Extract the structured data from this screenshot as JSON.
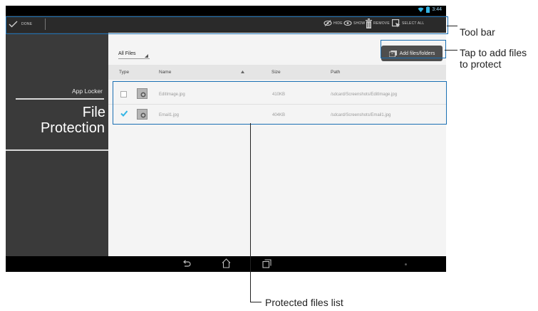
{
  "status_bar": {
    "time": "3:44"
  },
  "toolbar": {
    "done_label": "DONE",
    "hide_label": "HIDE",
    "show_label": "SHOW",
    "remove_label": "REMOVE",
    "select_all_label": "SELECT ALL"
  },
  "sidebar": {
    "app_name": "App Locker",
    "section_title_line1": "File",
    "section_title_line2": "Protection"
  },
  "main": {
    "filter_label": "All Files",
    "add_button_label": "Add files/folders",
    "columns": {
      "type": "Type",
      "name": "Name",
      "size": "Size",
      "path": "Path"
    },
    "rows": [
      {
        "checked": false,
        "name": "EditImage.jpg",
        "size": "410KB",
        "path": "/sdcard/Screenshots/EditImage.jpg"
      },
      {
        "checked": true,
        "name": "Email1.jpg",
        "size": "404KB",
        "path": "/sdcard/Screenshots/Email1.jpg"
      }
    ]
  },
  "callouts": {
    "toolbar": "Tool bar",
    "add_files_line1": "Tap to add files",
    "add_files_line2": "to protect",
    "files_list": "Protected files list"
  },
  "colors": {
    "accent": "#33b5e5",
    "highlight": "#1a6fb3"
  }
}
